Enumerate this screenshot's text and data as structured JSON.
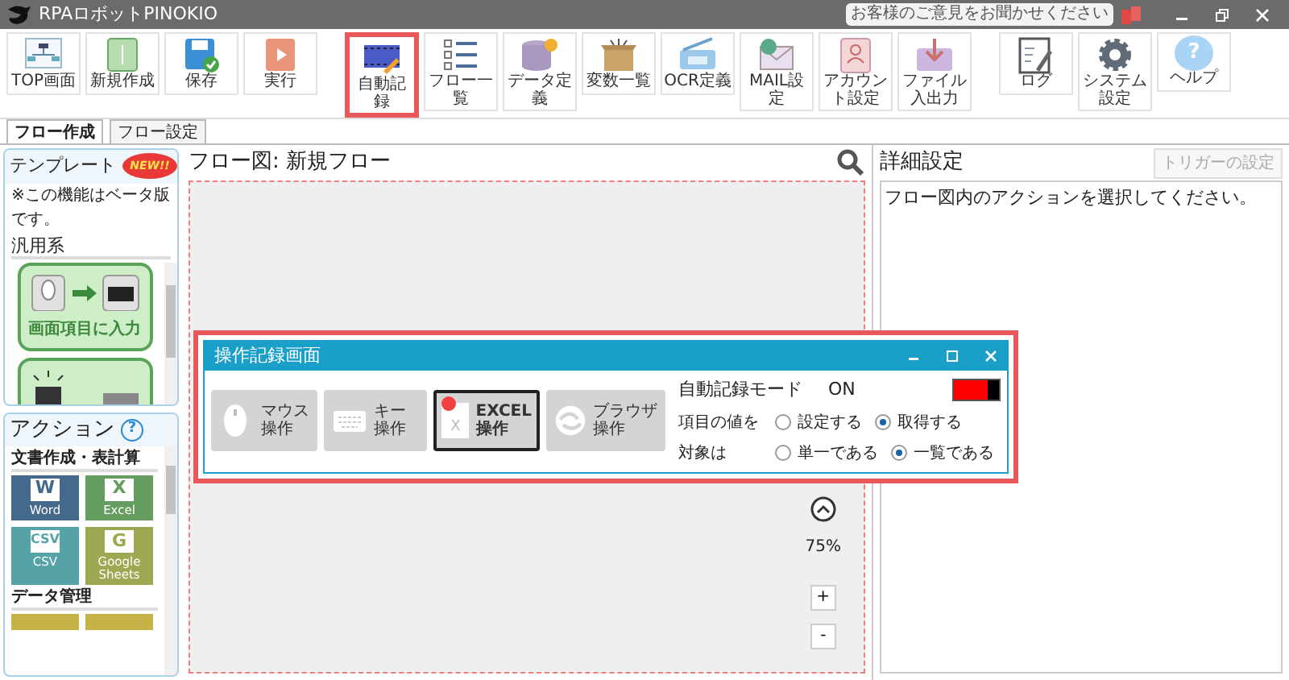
{
  "window": {
    "app_title": "RPAロボットPINOKIO",
    "feedback": "お客様のご意見をお聞かせください"
  },
  "toolbar": [
    {
      "label": "TOP画面",
      "gap_before": false,
      "highlighted": false
    },
    {
      "label": "新規作成",
      "gap_before": false,
      "highlighted": false
    },
    {
      "label": "保存",
      "gap_before": false,
      "highlighted": false
    },
    {
      "label": "実行",
      "gap_before": false,
      "highlighted": false
    },
    {
      "label": "自動記録",
      "gap_before": true,
      "highlighted": true
    },
    {
      "label": "フロー一覧",
      "gap_before": false,
      "highlighted": false
    },
    {
      "label": "データ定義",
      "gap_before": false,
      "highlighted": false
    },
    {
      "label": "変数一覧",
      "gap_before": false,
      "highlighted": false
    },
    {
      "label": "OCR定義",
      "gap_before": false,
      "highlighted": false
    },
    {
      "label": "MAIL設定",
      "gap_before": false,
      "highlighted": false
    },
    {
      "label": "アカウント設定",
      "gap_before": false,
      "highlighted": false
    },
    {
      "label": "ファイル入出力",
      "gap_before": false,
      "highlighted": false
    },
    {
      "label": "ログ",
      "gap_before": true,
      "highlighted": false
    },
    {
      "label": "システム設定",
      "gap_before": false,
      "highlighted": false
    },
    {
      "label": "ヘルプ",
      "gap_before": false,
      "highlighted": false,
      "glyph": "?"
    }
  ],
  "tabs": [
    {
      "label": "フロー作成",
      "selected": true
    },
    {
      "label": "フロー設定",
      "selected": false
    }
  ],
  "templates": {
    "title": "テンプレート",
    "badge": "NEW!!",
    "note": "※この機能はベータ版です。",
    "category": "汎用系",
    "cards": [
      {
        "kind": "input",
        "label": "画面項目に入力"
      },
      {
        "kind": "click"
      }
    ]
  },
  "actions": {
    "title": "アクション",
    "help_glyph": "?",
    "groups": [
      {
        "name": "文書作成・表計算",
        "tiles": [
          {
            "letter": "W",
            "label": "Word",
            "color": "#45698a"
          },
          {
            "letter": "X",
            "label": "Excel",
            "color": "#659c5f"
          },
          {
            "letter": "CSV",
            "label": "CSV",
            "color": "#55a3a6"
          },
          {
            "letter": "G",
            "label": "Google Sheets",
            "color": "#9ea852"
          }
        ]
      },
      {
        "name": "データ管理",
        "tiles": [
          {
            "color": "#c4b246"
          },
          {
            "color": "#c4b246"
          }
        ]
      }
    ]
  },
  "flow": {
    "title": "フロー図: 新規フロー",
    "zoom": "75%",
    "zoom_in": "+",
    "zoom_out": "-"
  },
  "recorder": {
    "title": "操作記録画面",
    "highlighted": true,
    "modes": [
      {
        "kind": "mouse",
        "lines": [
          "マウス",
          "操作"
        ],
        "selected": false
      },
      {
        "kind": "key",
        "lines": [
          "キー",
          "操作"
        ],
        "selected": false
      },
      {
        "kind": "excel",
        "lines": [
          "EXCEL",
          "操作"
        ],
        "selected": true,
        "glyph": "X"
      },
      {
        "kind": "browser",
        "lines": [
          "ブラウザ",
          "操作"
        ],
        "selected": false
      }
    ],
    "auto_label": "自動記録モード",
    "auto_value": "ON",
    "auto_on": true,
    "options": [
      {
        "label": "項目の値を",
        "choices": [
          {
            "label": "設定する",
            "selected": false
          },
          {
            "label": "取得する",
            "selected": true
          }
        ]
      },
      {
        "label": "対象は",
        "choices": [
          {
            "label": "単一である",
            "selected": false
          },
          {
            "label": "一覧である",
            "selected": true
          }
        ]
      }
    ]
  },
  "details": {
    "title": "詳細設定",
    "trigger_button": "トリガーの設定",
    "trigger_disabled": true,
    "message": "フロー図内のアクションを選択してください。"
  }
}
